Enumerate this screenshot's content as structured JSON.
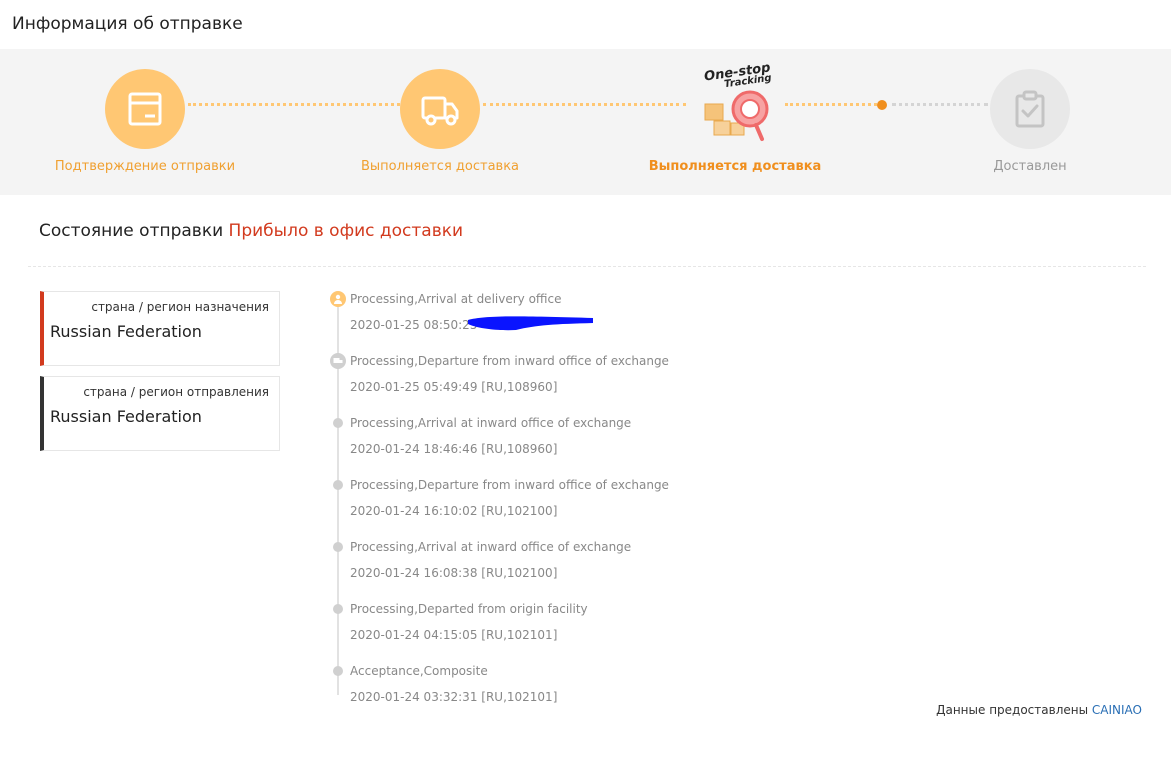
{
  "page": {
    "title": "Информация об отправке"
  },
  "steps": [
    {
      "label": "Подтверждение отправки",
      "icon": "package-icon"
    },
    {
      "label": "Выполняется доставка",
      "icon": "truck-icon"
    },
    {
      "label": "Выполняется доставка",
      "icon": "one-stop-tracking-badge",
      "badge_line1": "One-stop",
      "badge_line2": "Tracking"
    },
    {
      "label": "Доставлен",
      "icon": "clipboard-check-icon"
    }
  ],
  "status": {
    "label": "Состояние отправки",
    "value": "Прибыло в офис доставки"
  },
  "regions": {
    "destination": {
      "label": "страна / регион назначения",
      "value": "Russian Federation"
    },
    "origin": {
      "label": "страна / регион отправления",
      "value": "Russian Federation"
    }
  },
  "events": [
    {
      "title": "Processing,Arrival at delivery office",
      "time": "2020-01-25 08:50:25"
    },
    {
      "title": "Processing,Departure from inward office of exchange",
      "time": "2020-01-25 05:49:49 [RU,108960]"
    },
    {
      "title": "Processing,Arrival at inward office of exchange",
      "time": "2020-01-24 18:46:46 [RU,108960]"
    },
    {
      "title": "Processing,Departure from inward office of exchange",
      "time": "2020-01-24 16:10:02 [RU,102100]"
    },
    {
      "title": "Processing,Arrival at inward office of exchange",
      "time": "2020-01-24 16:08:38 [RU,102100]"
    },
    {
      "title": "Processing,Departed from origin facility",
      "time": "2020-01-24 04:15:05 [RU,102101]"
    },
    {
      "title": "Acceptance,Composite",
      "time": "2020-01-24 03:32:31 [RU,102101]"
    }
  ],
  "provider": {
    "label": "Данные предоставлены",
    "name": "CAINIAO"
  },
  "colors": {
    "accent_orange": "#f08f1e",
    "step_circle": "#ffc773",
    "status_red": "#d23a1e",
    "link_blue": "#2a6fb5",
    "redaction_blue": "#0a14ff"
  }
}
